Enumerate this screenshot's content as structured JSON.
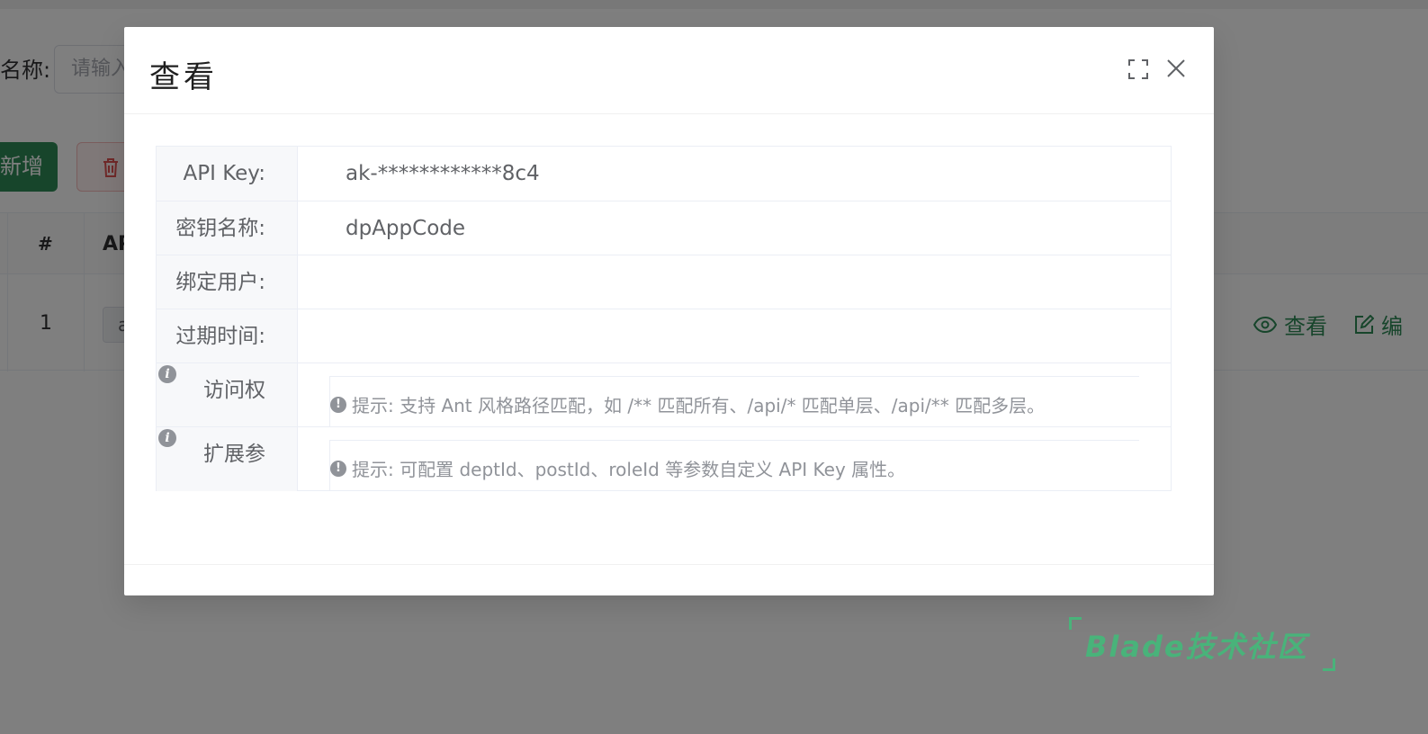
{
  "background": {
    "search_label": "名称:",
    "search_placeholder": "请输入",
    "add_button_label": "新增",
    "table": {
      "col_index": "#",
      "col_api": "API",
      "row_index": "1",
      "row_tag": "a",
      "action_view": "查看",
      "action_edit": "编"
    }
  },
  "dialog": {
    "title": "查看",
    "fields": [
      {
        "label": "API Key:",
        "value": "ak-************8c4"
      },
      {
        "label": "密钥名称:",
        "value": "dpAppCode"
      },
      {
        "label": "绑定用户:",
        "value": ""
      },
      {
        "label": "过期时间:",
        "value": ""
      },
      {
        "label": "访问权",
        "hint": "提示: 支持 Ant 风格路径匹配，如 /** 匹配所有、/api/* 匹配单层、/api/** 匹配多层。"
      },
      {
        "label": "扩展参",
        "hint": "提示: 可配置 deptId、postId、roleId 等参数自定义 API Key 属性。"
      }
    ]
  },
  "watermark": {
    "text": "Blade技术社区"
  },
  "colors": {
    "primary": "#2e8b57",
    "watermark": "#49b37a",
    "danger": "#e05252"
  }
}
